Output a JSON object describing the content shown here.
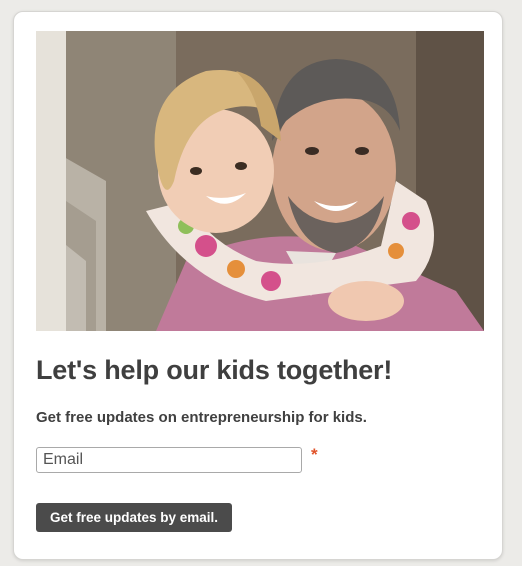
{
  "signup": {
    "photo_alt": "",
    "headline": "Let's help our kids together!",
    "subhead": "Get free updates on entrepreneurship for kids.",
    "email_placeholder": "Email",
    "required_marker": "*",
    "submit_label": "Get free updates by email."
  },
  "colors": {
    "page_background": "#ecebe8",
    "card_background": "#ffffff",
    "headline_text": "#3f3f3f",
    "required_marker": "#e0532a",
    "button_background": "#4b4b4b",
    "button_text": "#ffffff"
  }
}
